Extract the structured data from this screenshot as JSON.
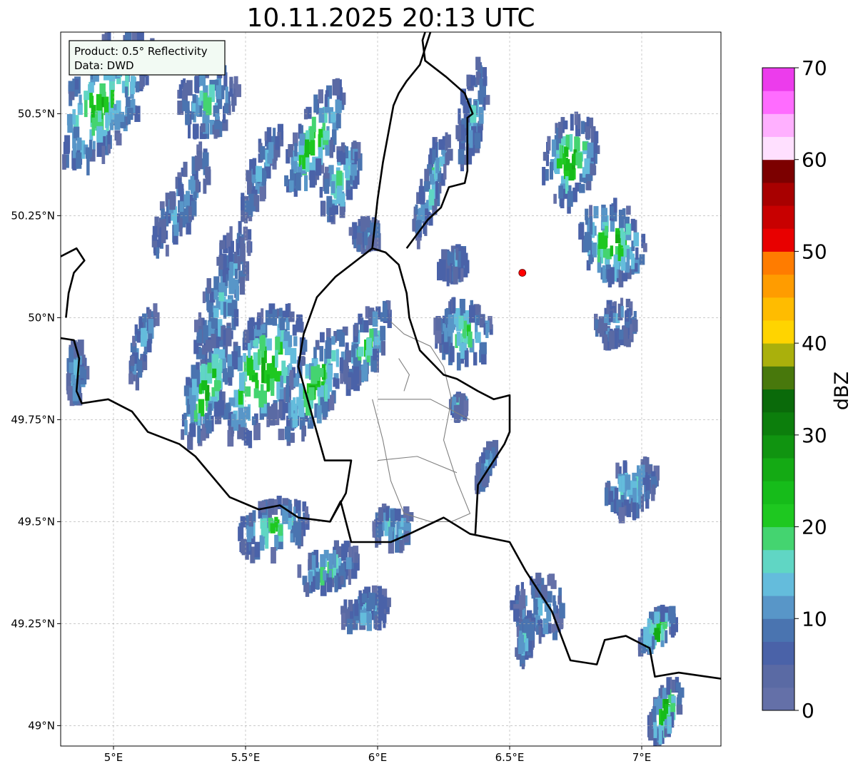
{
  "title": "10.11.2025 20:13 UTC",
  "info_box": {
    "product": "Product: 0.5° Reflectivity",
    "data": "Data: DWD"
  },
  "map": {
    "lon_range": [
      4.8,
      7.3
    ],
    "lat_range": [
      48.95,
      50.7
    ],
    "lon_ticks": [
      {
        "value": 5.0,
        "label": "5°E"
      },
      {
        "value": 5.5,
        "label": "5.5°E"
      },
      {
        "value": 6.0,
        "label": "6°E"
      },
      {
        "value": 6.5,
        "label": "6.5°E"
      },
      {
        "value": 7.0,
        "label": "7°E"
      }
    ],
    "lat_ticks": [
      {
        "value": 50.5,
        "label": "50.5°N"
      },
      {
        "value": 50.25,
        "label": "50.25°N"
      },
      {
        "value": 50.0,
        "label": "50°N"
      },
      {
        "value": 49.75,
        "label": "49.75°N"
      },
      {
        "value": 49.5,
        "label": "49.5°N"
      },
      {
        "value": 49.25,
        "label": "49.25°N"
      },
      {
        "value": 49.0,
        "label": "49°N"
      }
    ],
    "gridlines": true,
    "radar_site": {
      "lon": 6.548,
      "lat": 50.11,
      "color": "#ff0000"
    },
    "borders": [
      [
        [
          4.8,
          50.15
        ],
        [
          4.86,
          50.17
        ],
        [
          4.89,
          50.14
        ],
        [
          4.85,
          50.11
        ],
        [
          4.83,
          50.06
        ],
        [
          4.82,
          50.0
        ]
      ],
      [
        [
          4.8,
          49.95
        ],
        [
          4.85,
          49.945
        ],
        [
          4.87,
          49.9
        ],
        [
          4.86,
          49.82
        ],
        [
          4.88,
          49.79
        ],
        [
          4.98,
          49.8
        ],
        [
          5.07,
          49.77
        ],
        [
          5.13,
          49.72
        ],
        [
          5.25,
          49.69
        ],
        [
          5.31,
          49.66
        ],
        [
          5.44,
          49.56
        ],
        [
          5.55,
          49.53
        ],
        [
          5.63,
          49.54
        ],
        [
          5.7,
          49.51
        ],
        [
          5.82,
          49.5
        ],
        [
          5.86,
          49.55
        ],
        [
          5.9,
          49.45
        ],
        [
          6.05,
          49.45
        ],
        [
          6.12,
          49.47
        ],
        [
          6.25,
          49.51
        ],
        [
          6.35,
          49.47
        ],
        [
          6.5,
          49.45
        ],
        [
          6.56,
          49.38
        ],
        [
          6.6,
          49.34
        ],
        [
          6.66,
          49.28
        ],
        [
          6.73,
          49.16
        ],
        [
          6.83,
          49.15
        ],
        [
          6.86,
          49.21
        ],
        [
          6.94,
          49.22
        ],
        [
          7.03,
          49.19
        ],
        [
          7.05,
          49.12
        ],
        [
          7.14,
          49.13
        ],
        [
          7.3,
          49.115
        ]
      ],
      [
        [
          5.98,
          50.17
        ],
        [
          6.03,
          50.16
        ],
        [
          6.08,
          50.13
        ],
        [
          6.11,
          50.06
        ],
        [
          6.12,
          50.0
        ],
        [
          6.16,
          49.92
        ],
        [
          6.25,
          49.86
        ],
        [
          6.3,
          49.85
        ],
        [
          6.38,
          49.82
        ],
        [
          6.44,
          49.8
        ],
        [
          6.5,
          49.81
        ],
        [
          6.5,
          49.72
        ],
        [
          6.48,
          49.69
        ],
        [
          6.38,
          49.59
        ],
        [
          6.37,
          49.47
        ]
      ],
      [
        [
          5.98,
          50.17
        ],
        [
          5.84,
          50.1
        ],
        [
          5.77,
          50.05
        ],
        [
          5.72,
          49.96
        ],
        [
          5.7,
          49.88
        ],
        [
          5.8,
          49.65
        ],
        [
          5.9,
          49.65
        ],
        [
          5.88,
          49.57
        ],
        [
          5.82,
          49.5
        ]
      ],
      [
        [
          6.11,
          50.17
        ],
        [
          6.19,
          50.24
        ],
        [
          6.24,
          50.27
        ],
        [
          6.27,
          50.32
        ],
        [
          6.33,
          50.33
        ],
        [
          6.34,
          50.36
        ],
        [
          6.34,
          50.49
        ],
        [
          6.36,
          50.5
        ],
        [
          6.33,
          50.55
        ],
        [
          6.26,
          50.59
        ],
        [
          6.18,
          50.63
        ],
        [
          6.17,
          50.68
        ],
        [
          6.18,
          50.7
        ]
      ],
      [
        [
          6.2,
          50.7
        ],
        [
          6.16,
          50.62
        ],
        [
          6.11,
          50.58
        ],
        [
          6.08,
          50.55
        ],
        [
          6.06,
          50.52
        ],
        [
          6.04,
          50.45
        ],
        [
          6.02,
          50.38
        ],
        [
          6.0,
          50.29
        ],
        [
          5.98,
          50.17
        ]
      ]
    ],
    "regions": [
      [
        [
          6.05,
          49.99
        ],
        [
          6.1,
          49.96
        ],
        [
          6.2,
          49.93
        ],
        [
          6.25,
          49.88
        ],
        [
          6.28,
          49.8
        ],
        [
          6.25,
          49.7
        ],
        [
          6.3,
          49.6
        ],
        [
          6.35,
          49.52
        ],
        [
          6.28,
          49.5
        ],
        [
          6.2,
          49.5
        ],
        [
          6.1,
          49.52
        ],
        [
          6.05,
          49.6
        ],
        [
          6.02,
          49.7
        ],
        [
          5.98,
          49.8
        ]
      ],
      [
        [
          6.0,
          49.8
        ],
        [
          6.2,
          49.8
        ],
        [
          6.35,
          49.75
        ]
      ],
      [
        [
          6.0,
          49.65
        ],
        [
          6.15,
          49.66
        ],
        [
          6.3,
          49.62
        ]
      ],
      [
        [
          6.08,
          49.9
        ],
        [
          6.12,
          49.86
        ],
        [
          6.1,
          49.82
        ]
      ]
    ]
  },
  "colorbar": {
    "label": "dBZ",
    "min": 0,
    "max": 70,
    "step": 2.5,
    "tick_labels": [
      "0",
      "10",
      "20",
      "30",
      "40",
      "50",
      "60",
      "70"
    ],
    "tick_values": [
      0,
      10,
      20,
      30,
      40,
      50,
      60,
      70
    ],
    "colors": [
      "#6470a8",
      "#5a6aa4",
      "#4a62a8",
      "#4a74b0",
      "#5896c8",
      "#64bcdc",
      "#60d6c4",
      "#44d470",
      "#1ec820",
      "#16bc1a",
      "#14aa14",
      "#109410",
      "#0c7e0c",
      "#0a6a0a",
      "#48780c",
      "#aab00c",
      "#ffd400",
      "#ffbc00",
      "#ff9c00",
      "#ff7c00",
      "#e80000",
      "#c80000",
      "#a80000",
      "#7c0000",
      "#ffe0ff",
      "#ffb0ff",
      "#ff6cff",
      "#ec3cec"
    ]
  },
  "echoes": [
    {
      "lon": 4.95,
      "lat": 50.55,
      "w": 0.28,
      "h": 0.4,
      "a": 30,
      "i": 0.7
    },
    {
      "lon": 5.35,
      "lat": 50.55,
      "w": 0.22,
      "h": 0.18,
      "a": 20,
      "i": 0.5
    },
    {
      "lon": 5.25,
      "lat": 50.3,
      "w": 0.12,
      "h": 0.3,
      "a": 25,
      "i": 0.3
    },
    {
      "lon": 5.55,
      "lat": 50.38,
      "w": 0.08,
      "h": 0.25,
      "a": 20,
      "i": 0.3
    },
    {
      "lon": 5.75,
      "lat": 50.45,
      "w": 0.15,
      "h": 0.3,
      "a": 25,
      "i": 0.8
    },
    {
      "lon": 5.85,
      "lat": 50.35,
      "w": 0.12,
      "h": 0.2,
      "a": 20,
      "i": 0.6
    },
    {
      "lon": 5.95,
      "lat": 50.22,
      "w": 0.12,
      "h": 0.06,
      "a": 0,
      "i": 0.3
    },
    {
      "lon": 5.4,
      "lat": 50.05,
      "w": 0.15,
      "h": 0.4,
      "a": 15,
      "i": 0.4
    },
    {
      "lon": 5.55,
      "lat": 49.88,
      "w": 0.28,
      "h": 0.35,
      "a": 25,
      "i": 0.9
    },
    {
      "lon": 5.35,
      "lat": 49.85,
      "w": 0.15,
      "h": 0.3,
      "a": 20,
      "i": 0.8
    },
    {
      "lon": 5.75,
      "lat": 49.85,
      "w": 0.18,
      "h": 0.3,
      "a": 30,
      "i": 0.8
    },
    {
      "lon": 5.95,
      "lat": 49.95,
      "w": 0.14,
      "h": 0.22,
      "a": 25,
      "i": 0.6
    },
    {
      "lon": 5.1,
      "lat": 49.95,
      "w": 0.07,
      "h": 0.2,
      "a": 15,
      "i": 0.4
    },
    {
      "lon": 4.85,
      "lat": 49.88,
      "w": 0.07,
      "h": 0.15,
      "a": 0,
      "i": 0.5
    },
    {
      "lon": 5.6,
      "lat": 49.5,
      "w": 0.3,
      "h": 0.12,
      "a": -20,
      "i": 0.6
    },
    {
      "lon": 5.8,
      "lat": 49.4,
      "w": 0.25,
      "h": 0.1,
      "a": -25,
      "i": 0.5
    },
    {
      "lon": 5.95,
      "lat": 49.3,
      "w": 0.2,
      "h": 0.08,
      "a": -25,
      "i": 0.4
    },
    {
      "lon": 6.05,
      "lat": 49.5,
      "w": 0.15,
      "h": 0.1,
      "a": -10,
      "i": 0.5
    },
    {
      "lon": 6.2,
      "lat": 50.35,
      "w": 0.08,
      "h": 0.3,
      "a": 15,
      "i": 0.5
    },
    {
      "lon": 6.35,
      "lat": 50.52,
      "w": 0.1,
      "h": 0.25,
      "a": 10,
      "i": 0.4
    },
    {
      "lon": 6.32,
      "lat": 49.98,
      "w": 0.22,
      "h": 0.15,
      "a": -35,
      "i": 0.6
    },
    {
      "lon": 6.28,
      "lat": 50.15,
      "w": 0.12,
      "h": 0.06,
      "a": -20,
      "i": 0.3
    },
    {
      "lon": 6.72,
      "lat": 50.4,
      "w": 0.2,
      "h": 0.22,
      "a": 15,
      "i": 0.9
    },
    {
      "lon": 6.88,
      "lat": 50.2,
      "w": 0.25,
      "h": 0.2,
      "a": -20,
      "i": 0.8
    },
    {
      "lon": 6.9,
      "lat": 50.0,
      "w": 0.18,
      "h": 0.1,
      "a": -20,
      "i": 0.3
    },
    {
      "lon": 6.95,
      "lat": 49.6,
      "w": 0.17,
      "h": 0.15,
      "a": 40,
      "i": 0.5
    },
    {
      "lon": 6.6,
      "lat": 49.3,
      "w": 0.2,
      "h": 0.16,
      "a": 20,
      "i": 0.3
    },
    {
      "lon": 6.55,
      "lat": 49.22,
      "w": 0.06,
      "h": 0.1,
      "a": 10,
      "i": 0.6
    },
    {
      "lon": 7.05,
      "lat": 49.25,
      "w": 0.1,
      "h": 0.12,
      "a": 40,
      "i": 0.9
    },
    {
      "lon": 7.08,
      "lat": 49.05,
      "w": 0.1,
      "h": 0.16,
      "a": 20,
      "i": 0.9
    },
    {
      "lon": 6.4,
      "lat": 49.65,
      "w": 0.05,
      "h": 0.12,
      "a": 20,
      "i": 0.4
    },
    {
      "lon": 6.3,
      "lat": 49.8,
      "w": 0.06,
      "h": 0.04,
      "a": 0,
      "i": 0.5
    }
  ]
}
